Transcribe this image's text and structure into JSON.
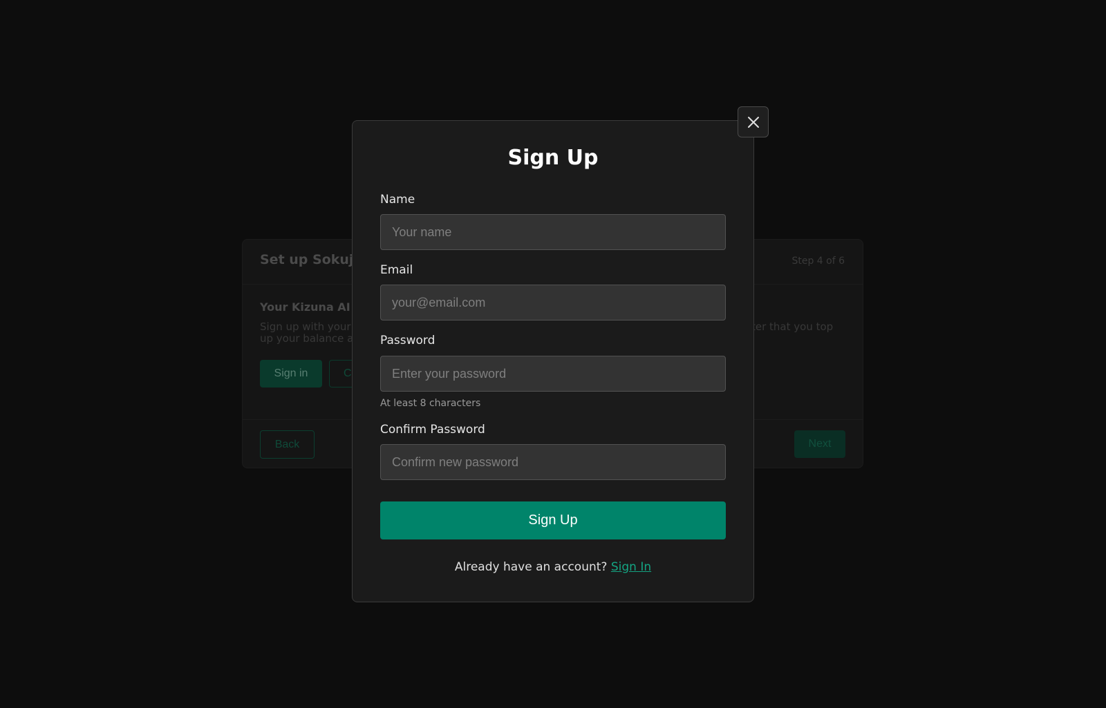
{
  "wizard": {
    "title": "Set up Sokuji",
    "step": "Step 4 of 6",
    "subtitle": "Your Kizuna AI a",
    "description_left": "Sign up with your c up your balance an",
    "description_right": "ter that you top",
    "signin_label": "Sign in",
    "create_label": "C",
    "back_label": "Back",
    "next_label": "Next"
  },
  "modal": {
    "title": "Sign Up",
    "close_icon": "close-icon",
    "fields": {
      "name": {
        "label": "Name",
        "placeholder": "Your name",
        "value": ""
      },
      "email": {
        "label": "Email",
        "placeholder": "your@email.com",
        "value": ""
      },
      "password": {
        "label": "Password",
        "placeholder": "Enter your password",
        "value": "",
        "hint": "At least 8 characters"
      },
      "confirm": {
        "label": "Confirm Password",
        "placeholder": "Confirm new password",
        "value": ""
      }
    },
    "submit_label": "Sign Up",
    "footer_text": "Already have an account?",
    "footer_link": "Sign In"
  },
  "colors": {
    "accent": "#00846a",
    "link": "#14a583",
    "modal_bg": "#1b1b1b",
    "input_bg": "#333333"
  }
}
